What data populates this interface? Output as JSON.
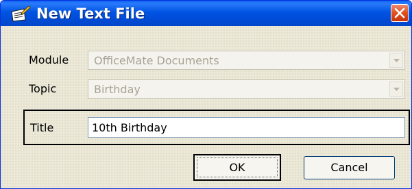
{
  "window": {
    "title": "New Text File",
    "icon": "new-text-file-icon",
    "colors": {
      "titlebar": "#0054e3",
      "close": "#e2501f",
      "face": "#ece9d8"
    }
  },
  "form": {
    "module_label": "Module",
    "module_value": "OfficeMate Documents",
    "topic_label": "Topic",
    "topic_value": "Birthday",
    "title_label": "Title",
    "title_value": "10th Birthday"
  },
  "buttons": {
    "ok_label": "OK",
    "cancel_label": "Cancel"
  }
}
